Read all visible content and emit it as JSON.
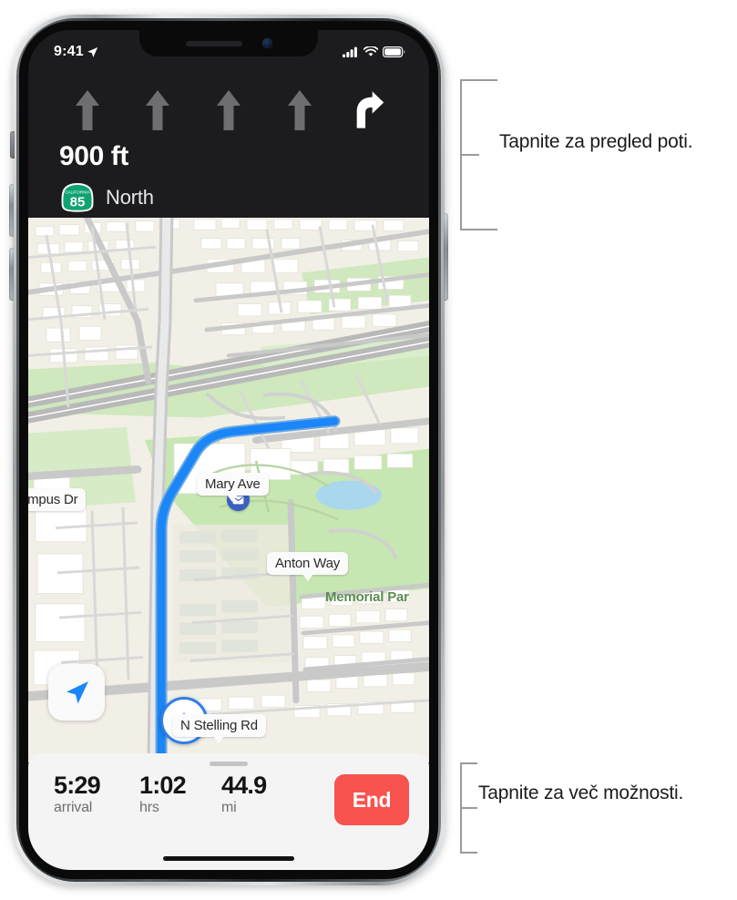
{
  "status_bar": {
    "time": "9:41",
    "location_icon": "location-arrow-icon",
    "cellular_icon": "cellular-bars-icon",
    "wifi_icon": "wifi-icon",
    "battery_icon": "battery-full-icon"
  },
  "nav_header": {
    "lanes": [
      {
        "type": "straight",
        "state": "inactive"
      },
      {
        "type": "straight",
        "state": "inactive"
      },
      {
        "type": "straight",
        "state": "inactive"
      },
      {
        "type": "straight",
        "state": "inactive"
      },
      {
        "type": "turn-right",
        "state": "active"
      }
    ],
    "distance": "900 ft",
    "shield": {
      "state_text": "CALIFORNIA",
      "number": "85",
      "color": "#0fa371"
    },
    "road_name": "North",
    "background_color": "#1c1c1e"
  },
  "map": {
    "labels": [
      {
        "id": "campus-dr",
        "text": "ampus Dr"
      },
      {
        "id": "mary-ave",
        "text": "Mary Ave"
      },
      {
        "id": "anton-way",
        "text": "Anton Way"
      },
      {
        "id": "n-stelling-rd",
        "text": "N Stelling Rd"
      }
    ],
    "park_label": "Memorial Par",
    "route_color": "#1a86f7",
    "park_color": "#c6e6b2",
    "land_color": "#f2efe6",
    "position_marker_icon": "navigation-arrow-icon",
    "poi_icon": "mail-icon",
    "locate_button_icon": "location-arrow-icon"
  },
  "bottom_sheet": {
    "stats": [
      {
        "value": "5:29",
        "label": "arrival"
      },
      {
        "value": "1:02",
        "label": "hrs"
      },
      {
        "value": "44.9",
        "label": "mi"
      }
    ],
    "end_button": "End",
    "end_button_color": "#f8534f"
  },
  "callouts": {
    "top": "Tapnite za pregled poti.",
    "bottom": "Tapnite za več možnosti."
  }
}
